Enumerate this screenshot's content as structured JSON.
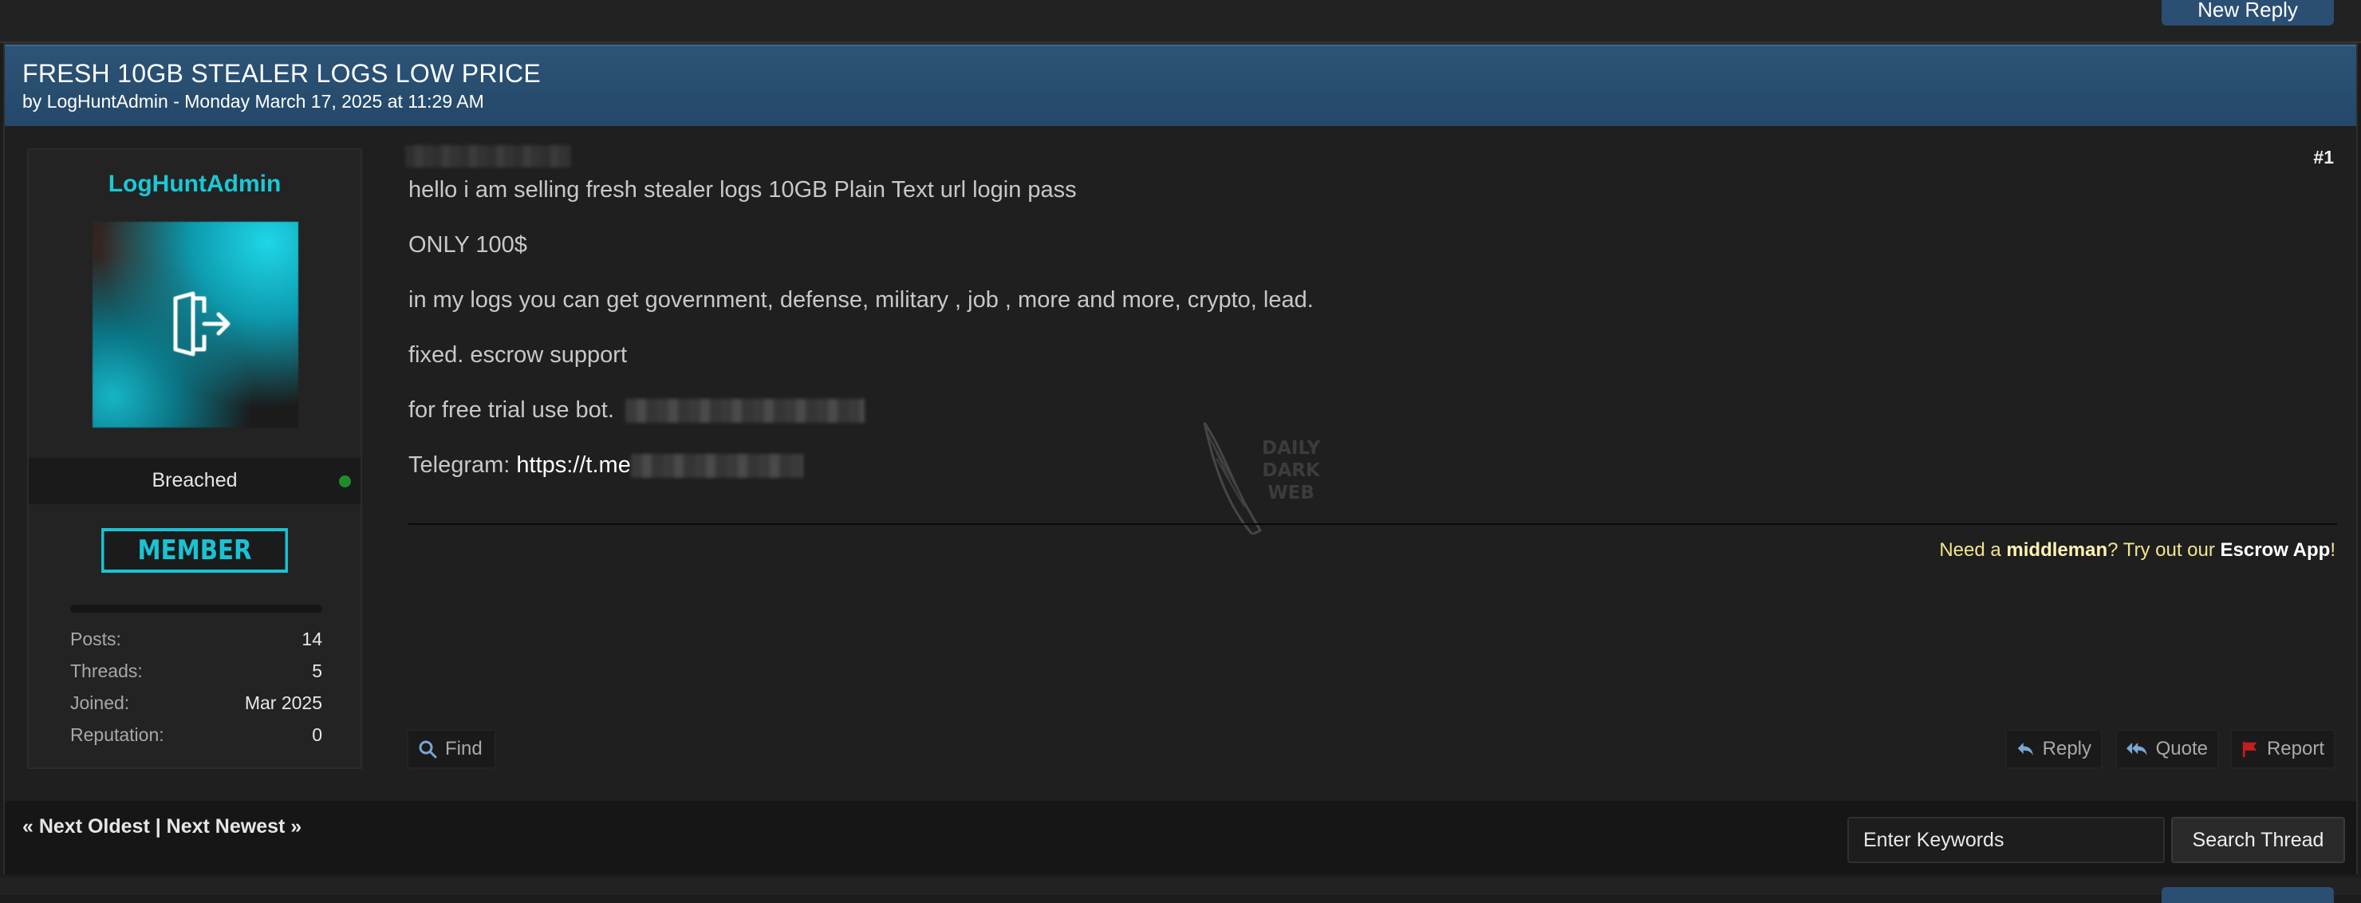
{
  "toolbar": {
    "new_reply_label": "New Reply"
  },
  "thread": {
    "title": "FRESH 10GB STEALER LOGS LOW PRICE",
    "meta": "by LogHuntAdmin - Monday March 17, 2025 at 11:29 AM"
  },
  "user": {
    "name": "LogHuntAdmin",
    "rank": "Breached",
    "badge": "MEMBER",
    "stats": [
      {
        "label": "Posts:",
        "value": "14"
      },
      {
        "label": "Threads:",
        "value": "5"
      },
      {
        "label": "Joined:",
        "value": "Mar 2025"
      },
      {
        "label": "Reputation:",
        "value": "0"
      }
    ]
  },
  "post": {
    "number": "#1",
    "lines": [
      "hello i am selling fresh stealer logs 10GB Plain Text url login pass",
      "ONLY 100$",
      "in my logs you can get government, defense, military , job , more and more, crypto, lead.",
      "fixed. escrow support",
      "for free trial use bot."
    ],
    "telegram_label": "Telegram:",
    "telegram_link": "https://t.me",
    "signature": {
      "pre": "Need a ",
      "bold1": "middleman",
      "mid": "? Try out our ",
      "bold2": "Escrow App",
      "post": "!"
    },
    "watermark": [
      "DAILY",
      "DARK",
      "WEB"
    ],
    "buttons": {
      "find": "Find",
      "reply": "Reply",
      "quote": "Quote",
      "report": "Report"
    }
  },
  "footer": {
    "nav": "« Next Oldest | Next Newest »",
    "search_placeholder": "Enter Keywords",
    "search_button": "Search Thread"
  },
  "colors": {
    "header": "#2c5477",
    "accent": "#1bc8d6",
    "online": "#1f8c2a",
    "report": "#c41e1e"
  }
}
